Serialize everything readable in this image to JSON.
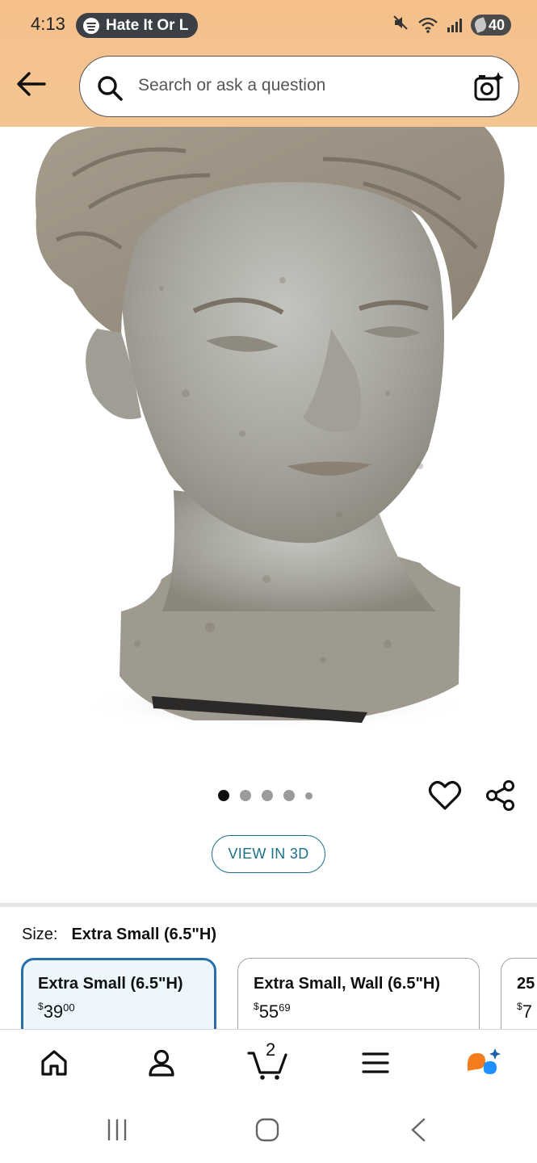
{
  "status_bar": {
    "time": "4:13",
    "media_text": "Hate It Or L",
    "battery": "40"
  },
  "search": {
    "placeholder": "Search or ask a question"
  },
  "carousel": {
    "dot_count": 5,
    "active_index": 0
  },
  "actions": {
    "view_3d_label": "VIEW IN 3D"
  },
  "size": {
    "label": "Size:",
    "selected_value": "Extra Small (6.5\"H)",
    "options": [
      {
        "name": "Extra Small (6.5\"H)",
        "currency": "$",
        "dollars": "39",
        "cents": "00",
        "selected": true
      },
      {
        "name": "Extra Small, Wall (6.5\"H)",
        "currency": "$",
        "dollars": "55",
        "cents": "69",
        "selected": false
      },
      {
        "name": "25",
        "currency": "$",
        "dollars": "7",
        "cents": "",
        "selected": false
      }
    ]
  },
  "bottom_nav": {
    "cart_count": "2",
    "items": [
      "home-icon",
      "account-icon",
      "cart-icon",
      "menu-icon",
      "rufus-icon"
    ]
  },
  "colors": {
    "header_bg": "#f5c08a",
    "link_teal": "#1e6f8a",
    "selected_border": "#2a6cac",
    "selected_bg": "#edf6fb",
    "rufus_orange": "#f37c1f",
    "rufus_blue": "#1e90ff"
  }
}
